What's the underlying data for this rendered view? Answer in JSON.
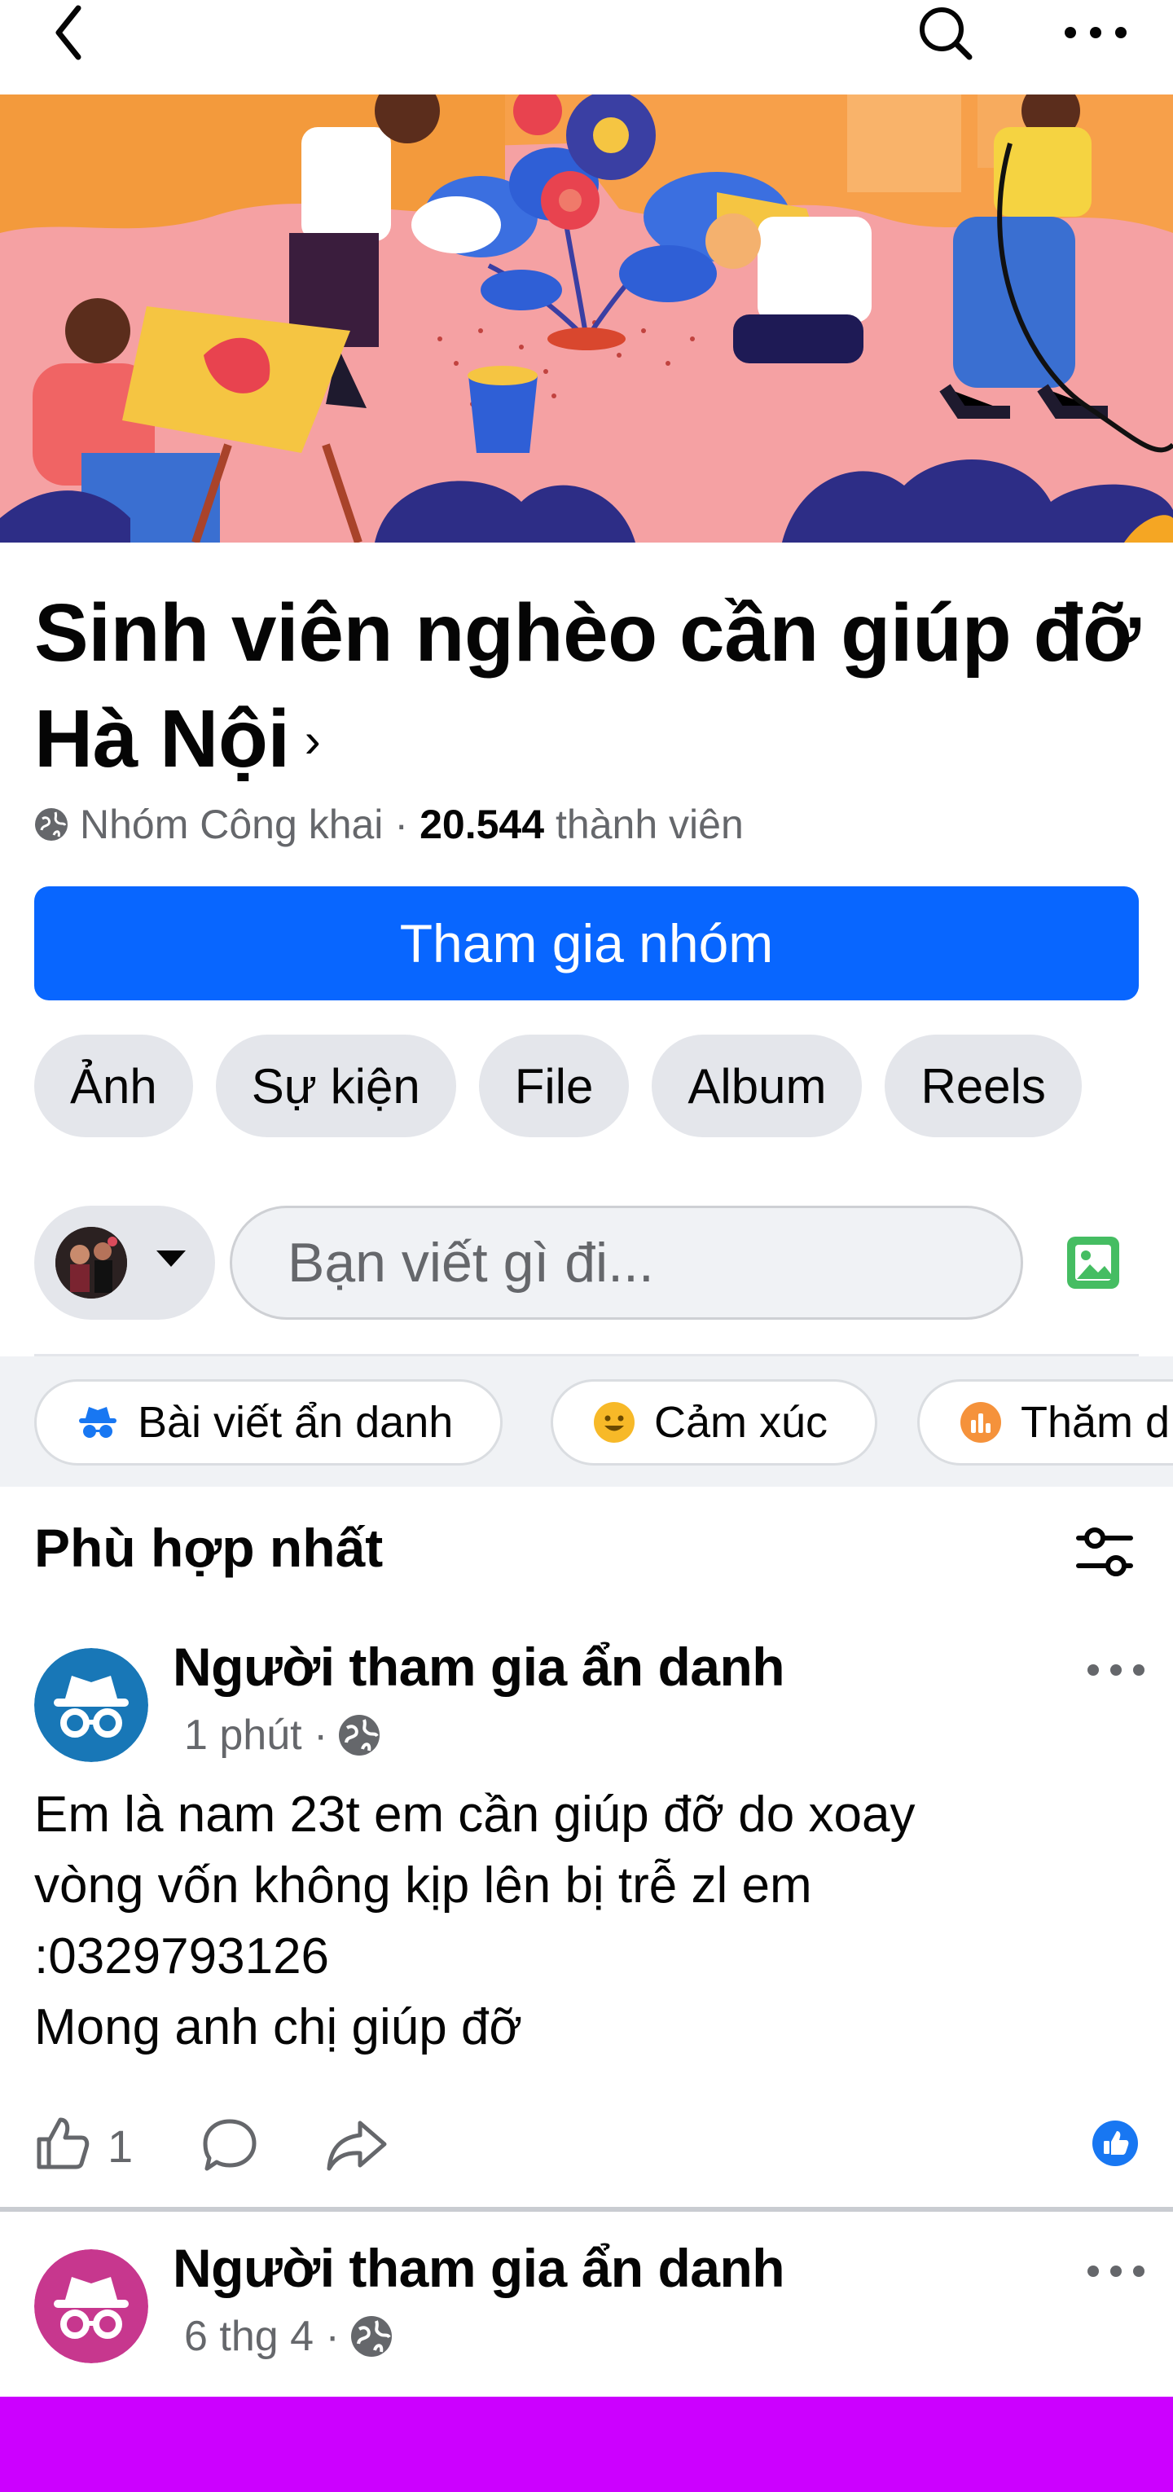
{
  "topbar": {
    "back_icon": "chevron-left-icon",
    "search_icon": "search-icon",
    "more_icon": "more-horizontal-icon"
  },
  "group": {
    "name": "Sinh viên nghèo cần giúp đỡ Hà Nội",
    "chevron": "›",
    "privacy": "Nhóm Công khai",
    "separator": "·",
    "member_count": "20.544",
    "member_label": "thành viên",
    "join_label": "Tham gia nhóm"
  },
  "tabs": [
    {
      "label": "Ảnh"
    },
    {
      "label": "Sự kiện"
    },
    {
      "label": "File"
    },
    {
      "label": "Album"
    },
    {
      "label": "Reels"
    }
  ],
  "composer": {
    "placeholder": "Bạn viết gì đi...",
    "photo_icon": "photo-icon"
  },
  "chips": [
    {
      "label": "Bài viết ẩn danh",
      "icon": "anonymous-icon"
    },
    {
      "label": "Cảm xúc",
      "icon": "smiley-icon"
    },
    {
      "label": "Thăm d",
      "icon": "poll-icon"
    }
  ],
  "feed": {
    "sort_label": "Phù hợp nhất",
    "filter_icon": "filter-icon"
  },
  "posts": [
    {
      "author": "Người tham gia ẩn danh",
      "time": "1 phút ·",
      "avatar_color": "#1877b7",
      "body": [
        "Em là nam 23t em cần giúp đỡ do xoay",
        "vòng vốn không kịp lên bị trễ zl em",
        ":0329793126",
        "Mong anh chị giúp đỡ"
      ],
      "like_count": "1"
    },
    {
      "author": "Người tham gia ẩn danh",
      "time": "6 thg 4 ·",
      "avatar_color": "#c7378e"
    }
  ],
  "colors": {
    "primary": "#0866ff",
    "chip_bg": "#e4e6eb",
    "bottom_bar": "#cc00ff"
  }
}
